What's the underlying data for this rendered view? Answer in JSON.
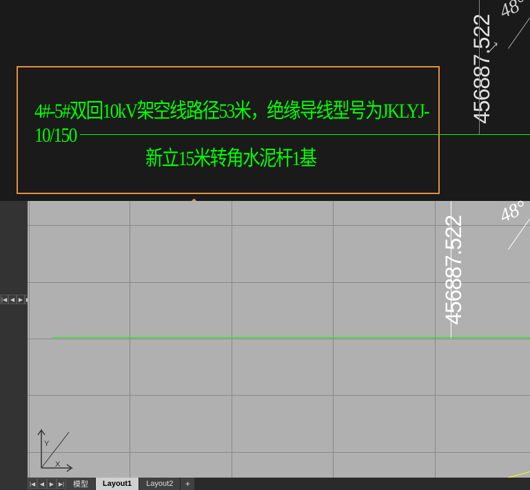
{
  "annotation": {
    "line1": "4#-5#双回10kV架空线路径53米，绝缘导线型号为JKLYJ-10/150",
    "line2": "新立15米转角水泥杆1基"
  },
  "dimension": {
    "value": "456887.522"
  },
  "angle": {
    "value": "48°"
  },
  "tabs": {
    "model": "模型",
    "layout1": "Layout1",
    "layout2": "Layout2",
    "add": "+"
  },
  "ucs": {
    "x_label": "X",
    "y_label": "Y"
  },
  "nav": {
    "first": "|◀",
    "prev": "◀",
    "next": "▶",
    "last": "▶|"
  }
}
